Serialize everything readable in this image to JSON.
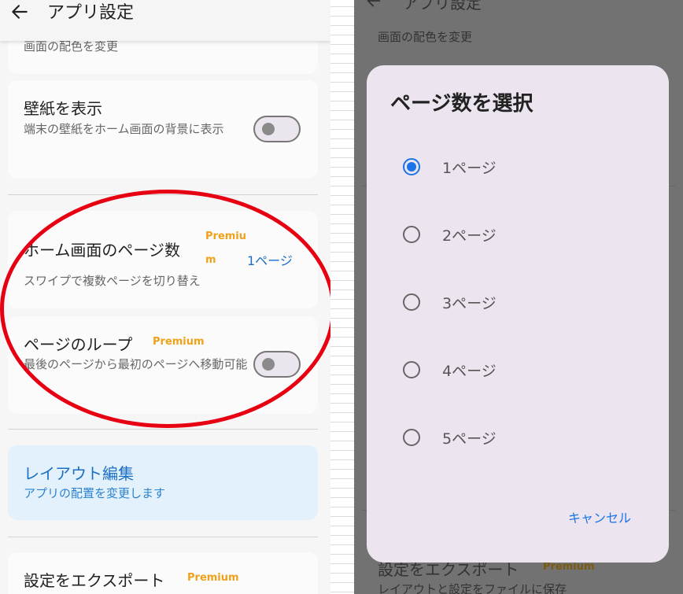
{
  "left": {
    "header": {
      "title": "アプリ設定"
    },
    "color_card": {
      "desc": "画面の配色を変更"
    },
    "wallpaper_card": {
      "title": "壁紙を表示",
      "desc": "端末の壁紙をホーム画面の背景に表示",
      "toggle_on": false
    },
    "pages_card": {
      "title": "ホーム画面のページ数",
      "premium": "Premium",
      "value": "1ページ",
      "desc": "スワイプで複数ページを切り替え"
    },
    "loop_card": {
      "title": "ページのループ",
      "premium": "Premium",
      "desc": "最後のページから最初のページへ移動可能",
      "toggle_on": false
    },
    "layout_card": {
      "title": "レイアウト編集",
      "desc": "アプリの配置を変更します"
    },
    "export_card": {
      "title": "設定をエクスポート",
      "premium": "Premium"
    }
  },
  "right": {
    "background": {
      "header_title": "アプリ設定",
      "color_desc": "画面の配色を変更",
      "export_title": "設定をエクスポート",
      "export_premium": "Premium",
      "export_desc": "レイアウトと設定をファイルに保存"
    },
    "dialog": {
      "title": "ページ数を選択",
      "options": [
        {
          "label": "1ページ",
          "selected": true
        },
        {
          "label": "2ページ",
          "selected": false
        },
        {
          "label": "3ページ",
          "selected": false
        },
        {
          "label": "4ページ",
          "selected": false
        },
        {
          "label": "5ページ",
          "selected": false
        }
      ],
      "cancel_label": "キャンセル"
    }
  },
  "colors": {
    "accent": "#1a73e8",
    "premium": "#f0a11a",
    "annotation": "#e60012",
    "scrim": "#727272"
  }
}
